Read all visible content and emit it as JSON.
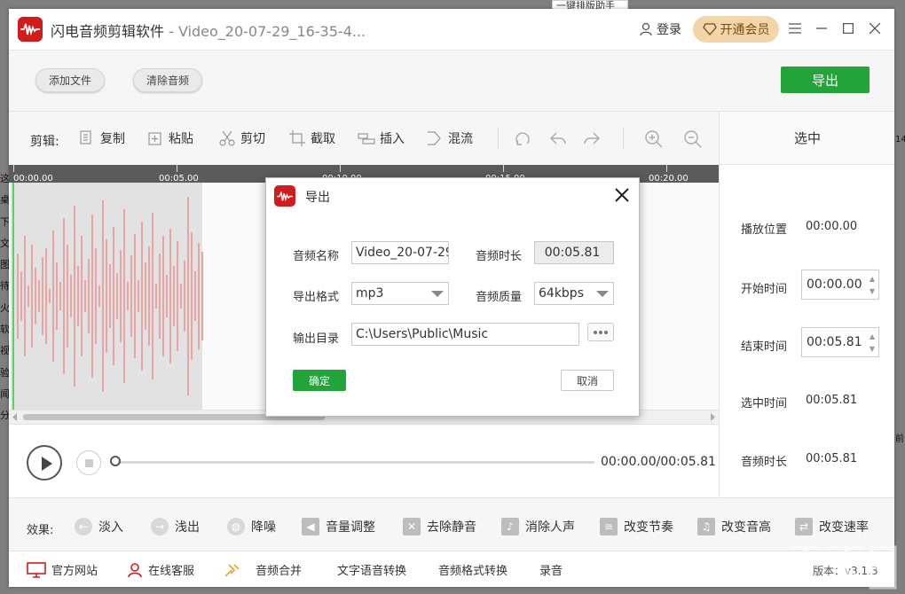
{
  "desktop": {
    "top_strip": "一键排版助手",
    "left_chars": [
      "这",
      "桌",
      "下",
      "文",
      "图",
      "待",
      "火",
      "软",
      "视",
      "验",
      "闻",
      "分"
    ],
    "right_chars": [
      "14:",
      "前"
    ]
  },
  "app": {
    "title": "闪电音频剪辑软件",
    "title_sep": " - ",
    "file": "Video_20-07-29_16-35-4...",
    "login": "登录",
    "vip": "开通会员"
  },
  "toolbar": {
    "add_file": "添加文件",
    "clear_audio": "清除音频",
    "export": "导出"
  },
  "edit": {
    "label": "剪辑:",
    "tools": [
      "复制",
      "粘贴",
      "剪切",
      "截取",
      "插入",
      "混流"
    ]
  },
  "timeline": {
    "ticks": [
      "00:00.00",
      "00:05.00",
      "00:10.00",
      "00:15.00",
      "00:20.00"
    ]
  },
  "player": {
    "time_readout": "00:00.00/00:05.81"
  },
  "right_panel": {
    "title": "选中",
    "play_pos_label": "播放位置",
    "play_pos": "00:00.00",
    "start_label": "开始时间",
    "start": "00:00.00",
    "end_label": "结束时间",
    "end": "00:05.81",
    "sel_label": "选中时间",
    "sel": "00:05.81",
    "dur_label": "音频时长",
    "dur": "00:05.81"
  },
  "effects": {
    "label": "效果:",
    "items": [
      "淡入",
      "浅出",
      "降噪",
      "音量调整",
      "去除静音",
      "消除人声",
      "改变节奏",
      "改变音高",
      "改变速率"
    ]
  },
  "footer": {
    "items": [
      "官方网站",
      "在线客服",
      "音频合并",
      "文字语音转换",
      "音频格式转换",
      "录音"
    ],
    "version": "版本：v3.1.3"
  },
  "dialog": {
    "title": "导出",
    "name_label": "音频名称",
    "name_value": "Video_20-07-29",
    "duration_label": "音频时长",
    "duration_value": "00:05.81",
    "format_label": "导出格式",
    "format_value": "mp3",
    "quality_label": "音频质量",
    "quality_value": "64kbps",
    "dir_label": "输出目录",
    "dir_value": "C:\\Users\\Public\\Music",
    "ok": "确定",
    "cancel": "取消"
  },
  "colors": {
    "brand_red": "#d01c1c",
    "green": "#22a43a",
    "wave": "#e8a3a3",
    "vip_bg": "#f2d6a9"
  }
}
